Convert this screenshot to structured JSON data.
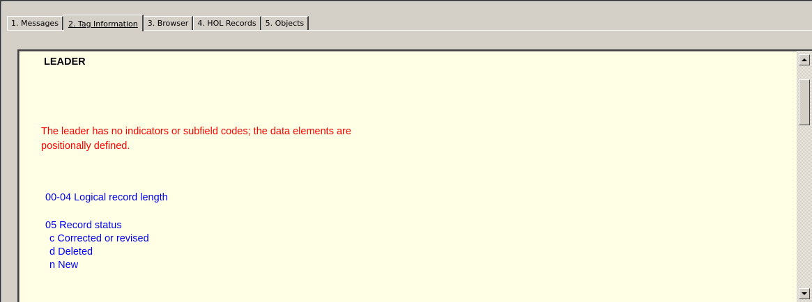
{
  "tabs": [
    {
      "label": "1. Messages",
      "active": false
    },
    {
      "label": "2. Tag Information",
      "active": true
    },
    {
      "label": "3. Browser",
      "active": false
    },
    {
      "label": "4. HOL Records",
      "active": false
    },
    {
      "label": "5. Objects",
      "active": false
    }
  ],
  "content": {
    "heading": "LEADER",
    "note_line1": "The leader has no indicators or subfield codes; the data elements are",
    "note_line2": "positionally defined.",
    "entries": [
      {
        "title": "00-04 Logical record length",
        "codes": []
      },
      {
        "title": "05 Record status",
        "codes": [
          "c Corrected or revised",
          "d Deleted",
          "n New"
        ]
      }
    ]
  },
  "colors": {
    "panel_background": "#ffffe6",
    "note_text": "#ff0000",
    "entry_text": "#0000ee",
    "heading_text": "#000000",
    "chrome": "#d4d0c8"
  },
  "scrollbar": {
    "up_icon": "scroll-up-arrow-icon",
    "down_icon": "scroll-down-arrow-icon"
  }
}
